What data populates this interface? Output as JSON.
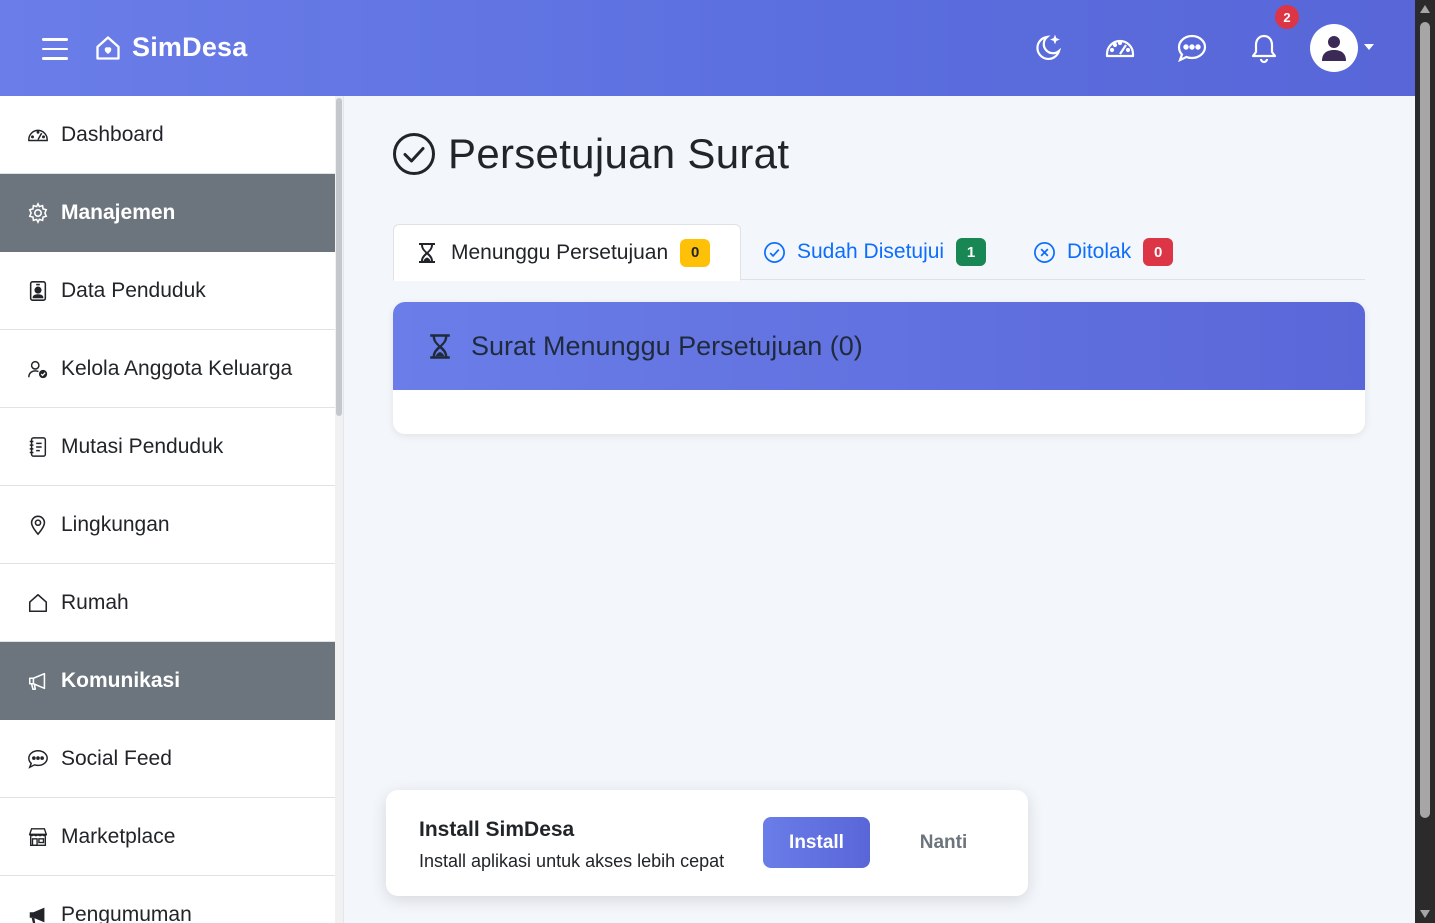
{
  "app": {
    "brand": "SimDesa"
  },
  "header": {
    "icons": [
      "theme-moon-icon",
      "dashboard-gauge-icon",
      "chat-icon",
      "bell-icon"
    ],
    "notification_count": "2",
    "accent": "#5f72e2"
  },
  "sidebar": {
    "items": [
      {
        "label": "Dashboard",
        "icon": "speedometer-icon",
        "section": false
      },
      {
        "label": "Manajemen",
        "icon": "gear-icon",
        "section": true
      },
      {
        "label": "Data Penduduk",
        "icon": "person-badge-icon",
        "section": false
      },
      {
        "label": "Kelola Anggota Keluarga",
        "icon": "person-check-icon",
        "section": false
      },
      {
        "label": "Mutasi Penduduk",
        "icon": "journal-text-icon",
        "section": false
      },
      {
        "label": "Lingkungan",
        "icon": "geo-pin-icon",
        "section": false
      },
      {
        "label": "Rumah",
        "icon": "house-icon",
        "section": false
      },
      {
        "label": "Komunikasi",
        "icon": "megaphone-icon",
        "section": true
      },
      {
        "label": "Social Feed",
        "icon": "chat-dots-icon",
        "section": false
      },
      {
        "label": "Marketplace",
        "icon": "shop-icon",
        "section": false
      },
      {
        "label": "Pengumuman",
        "icon": "megaphone-fill-icon",
        "section": false
      }
    ]
  },
  "main": {
    "title": "Persetujuan Surat",
    "tabs": [
      {
        "label": "Menunggu Persetujuan",
        "count": "0",
        "status": "warning"
      },
      {
        "label": "Sudah Disetujui",
        "count": "1",
        "status": "success"
      },
      {
        "label": "Ditolak",
        "count": "0",
        "status": "danger"
      }
    ],
    "card_title": "Surat Menunggu Persetujuan (0)"
  },
  "install_prompt": {
    "title": "Install SimDesa",
    "subtitle": "Install aplikasi untuk akses lebih cepat",
    "install_label": "Install",
    "later_label": "Nanti"
  }
}
